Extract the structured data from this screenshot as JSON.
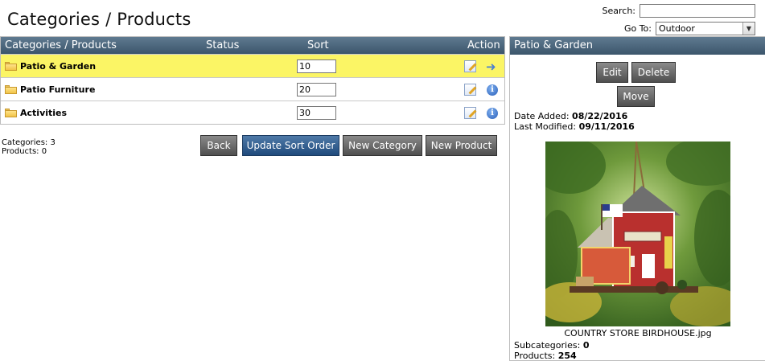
{
  "page": {
    "title": "Categories / Products"
  },
  "search": {
    "label": "Search:",
    "value": "",
    "goto_label": "Go To:",
    "goto_value": "Outdoor"
  },
  "table": {
    "headers": {
      "name": "Categories / Products",
      "status": "Status",
      "sort": "Sort",
      "action": "Action"
    },
    "rows": [
      {
        "name": "Patio & Garden",
        "sort": "10",
        "selected": true
      },
      {
        "name": "Patio Furniture",
        "sort": "20",
        "selected": false
      },
      {
        "name": "Activities",
        "sort": "30",
        "selected": false
      }
    ]
  },
  "counts": {
    "categories": "Categories: 3",
    "products": "Products: 0"
  },
  "buttons": {
    "back": "Back",
    "update_sort": "Update Sort Order",
    "new_category": "New Category",
    "new_product": "New Product"
  },
  "panel": {
    "title": "Patio & Garden",
    "edit": "Edit",
    "delete": "Delete",
    "move": "Move",
    "date_added_label": "Date Added:",
    "date_added": "08/22/2016",
    "last_modified_label": "Last Modified:",
    "last_modified": "09/11/2016",
    "image_caption": "COUNTRY STORE BIRDHOUSE.jpg",
    "subcategories_label": "Subcategories:",
    "subcategories": "0",
    "products_label": "Products:",
    "products": "254"
  },
  "colors": {
    "header_bar": "#4a6479",
    "selected_row": "#fbf565",
    "update_button": "#2d5a8c"
  },
  "icons": {
    "folder": "folder-icon",
    "edit": "edit-icon",
    "go": "arrow-right-icon",
    "info": "info-icon",
    "dropdown": "chevron-down-icon"
  }
}
